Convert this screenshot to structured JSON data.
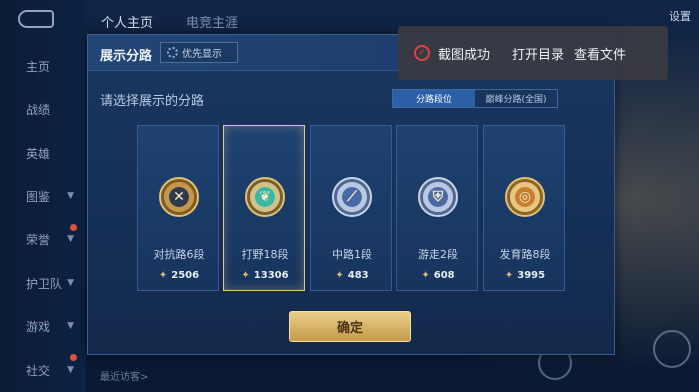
{
  "sidebar": {
    "items": [
      {
        "label": "主页",
        "chevron": false,
        "dot": false
      },
      {
        "label": "战绩",
        "chevron": false,
        "dot": false
      },
      {
        "label": "英雄",
        "chevron": false,
        "dot": false
      },
      {
        "label": "图鉴",
        "chevron": true,
        "dot": false
      },
      {
        "label": "荣誉",
        "chevron": true,
        "dot": true
      },
      {
        "label": "护卫队",
        "chevron": true,
        "dot": false
      },
      {
        "label": "游戏",
        "chevron": true,
        "dot": false
      },
      {
        "label": "社交",
        "chevron": true,
        "dot": true
      }
    ]
  },
  "header": {
    "tab_profile": "个人主页",
    "tab_esports": "电竞主涯",
    "settings": "设置"
  },
  "bottom": {
    "recent_visitors": "最近访客>"
  },
  "modal": {
    "title": "展示分路",
    "pref_button": "优先显示",
    "subtitle": "请选择展示的分路",
    "toggle": [
      "分路段位",
      "巅峰分路(全国)"
    ],
    "cards": [
      {
        "name": "对抗路6段",
        "score": "2506",
        "glyph": "✕"
      },
      {
        "name": "打野18段",
        "score": "13306",
        "glyph": "❦"
      },
      {
        "name": "中路1段",
        "score": "483",
        "glyph": "⟋"
      },
      {
        "name": "游走2段",
        "score": "608",
        "glyph": "⛨"
      },
      {
        "name": "发育路8段",
        "score": "3995",
        "glyph": "◎"
      }
    ],
    "selected_index": 1,
    "confirm": "确定"
  },
  "toast": {
    "message": "截图成功",
    "open_folder": "打开目录",
    "view_file": "查看文件"
  },
  "colors": {
    "accent_gold": "#e6c98a",
    "toast_icon": "#e0443a",
    "toggle_active": "#2b5fa6"
  }
}
